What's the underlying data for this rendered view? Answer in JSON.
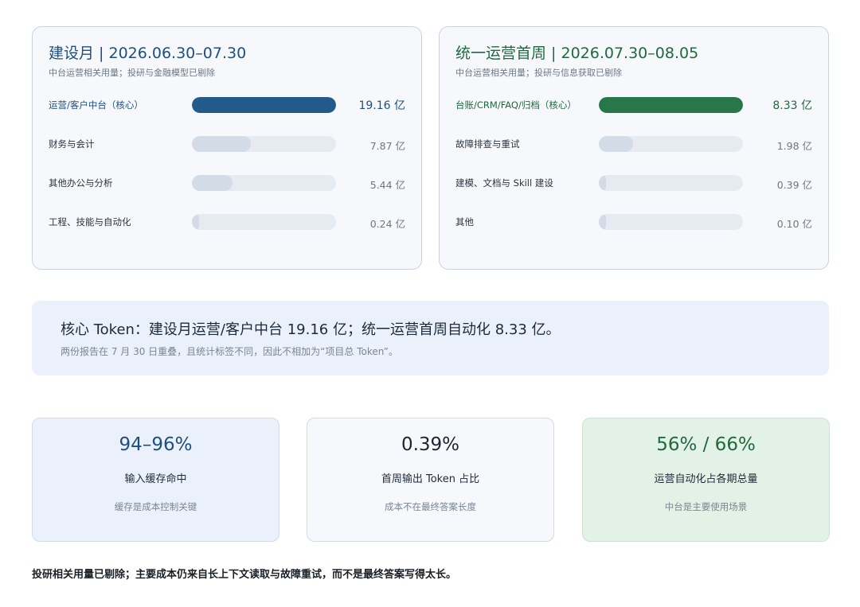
{
  "chart_data": [
    {
      "type": "bar",
      "title": "建设月 | 2026.06.30–07.30",
      "subtitle": "中台运营相关用量；投研与金融模型已剔除",
      "unit": "亿",
      "scale_max": 19.16,
      "categories": [
        "运营/客户中台（核心）",
        "财务与会计",
        "其他办公与分析",
        "工程、技能与自动化"
      ],
      "values": [
        19.16,
        7.87,
        5.44,
        0.24
      ],
      "value_labels": [
        "19.16 亿",
        "7.87 亿",
        "5.44 亿",
        "0.24 亿"
      ],
      "accent": "#235a8a"
    },
    {
      "type": "bar",
      "title": "统一运营首周 | 2026.07.30–08.05",
      "subtitle": "中台运营相关用量；投研与信息获取已剔除",
      "unit": "亿",
      "scale_max": 8.33,
      "categories": [
        "台账/CRM/FAQ/归档（核心）",
        "故障排查与重试",
        "建模、文档与 Skill 建设",
        "其他"
      ],
      "values": [
        8.33,
        1.98,
        0.39,
        0.1
      ],
      "value_labels": [
        "8.33 亿",
        "1.98 亿",
        "0.39 亿",
        "0.10 亿"
      ],
      "accent": "#27774a"
    }
  ],
  "banner": {
    "title": "核心 Token：建设月运营/客户中台 19.16 亿；统一运营首周自动化 8.33 亿。",
    "subtitle": "两份报告在 7 月 30 日重叠，且统计标签不同，因此不相加为“项目总 Token”。"
  },
  "cards": [
    {
      "value": "94–96%",
      "label": "输入缓存命中",
      "note": "缓存是成本控制关键",
      "color": "#1f4f7f"
    },
    {
      "value": "0.39%",
      "label": "首周输出 Token 占比",
      "note": "成本不在最终答案长度",
      "color": "#1c2530"
    },
    {
      "value": "56% / 66%",
      "label": "运营自动化占各期总量",
      "note": "中台是主要使用场景",
      "color": "#21683f"
    }
  ],
  "footer": "投研相关用量已剔除；主要成本仍来自长上下文读取与故障重试，而不是最终答案写得太长。"
}
